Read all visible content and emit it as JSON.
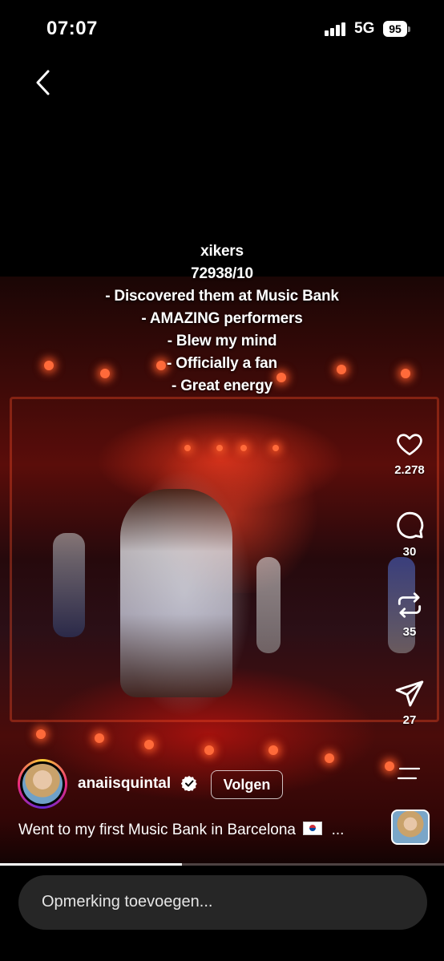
{
  "status_bar": {
    "time": "07:07",
    "network": "5G",
    "battery": "95"
  },
  "overlay_text": [
    "xikers",
    "72938/10",
    "- Discovered them at Music Bank",
    "- AMAZING performers",
    "- Blew my mind",
    "- Officially a fan",
    "- Great energy"
  ],
  "actions": {
    "likes": "2.278",
    "comments": "30",
    "reposts": "35",
    "shares": "27"
  },
  "author": {
    "username": "anaiisquintal",
    "follow_label": "Volgen"
  },
  "description": "Went to my first Music Bank in Barcelona",
  "description_ellipsis": "...",
  "playback_progress": 0.41,
  "comment_placeholder": "Opmerking toevoegen..."
}
